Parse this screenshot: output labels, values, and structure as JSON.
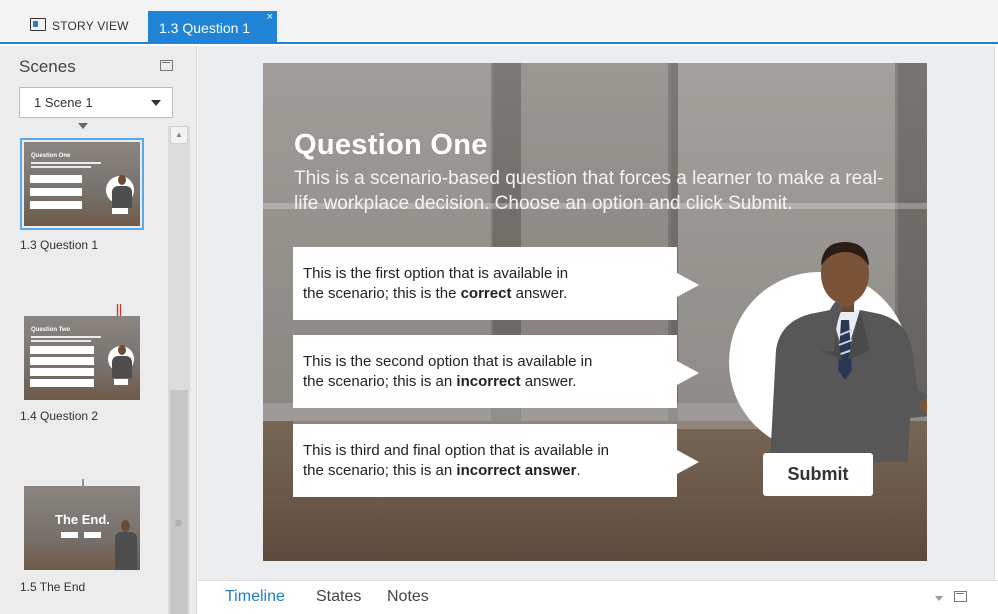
{
  "tabs": {
    "story_view": "STORY VIEW",
    "active": "1.3 Question 1",
    "close_glyph": "×"
  },
  "scenes_panel": {
    "title": "Scenes",
    "selected_scene": "1 Scene 1",
    "slides": [
      {
        "label": "1.3 Question 1",
        "thumb_title": "Question One",
        "selected": true
      },
      {
        "label": "1.4 Question 2",
        "thumb_title": "Question Two",
        "selected": false
      },
      {
        "label": "1.5 The End",
        "thumb_title": "The End.",
        "selected": false
      }
    ],
    "grip_glyph": "≡",
    "scroll_up_glyph": "▲"
  },
  "slide": {
    "title": "Question One",
    "subtitle": "This is a scenario-based question that forces a learner to make a real-life workplace decision. Choose an option and click Submit.",
    "options": [
      {
        "line1": "This is the first option that is available in",
        "pre": "the scenario; this is the ",
        "bold": "correct",
        "post": " answer."
      },
      {
        "line1": "This is the second option that is available in",
        "pre": "the scenario; this is an ",
        "bold": "incorrect",
        "post": " answer."
      },
      {
        "line1": "This is third and final option that is available in",
        "pre": "the scenario; this is an ",
        "bold": "incorrect answer",
        "post": "."
      }
    ],
    "submit_label": "Submit"
  },
  "bottom_panel": {
    "tabs": [
      "Timeline",
      "States",
      "Notes"
    ],
    "active_tab": "Timeline"
  },
  "colors": {
    "accent": "#1f84d6",
    "active_tab_text": "#1f7fc8",
    "slide_arrow": "#c0392b"
  },
  "icons": [
    "story-view-icon",
    "close-icon",
    "popout-icon",
    "chevron-down-icon",
    "arrow-down-icon",
    "scroll-up-icon",
    "grip-icon"
  ]
}
